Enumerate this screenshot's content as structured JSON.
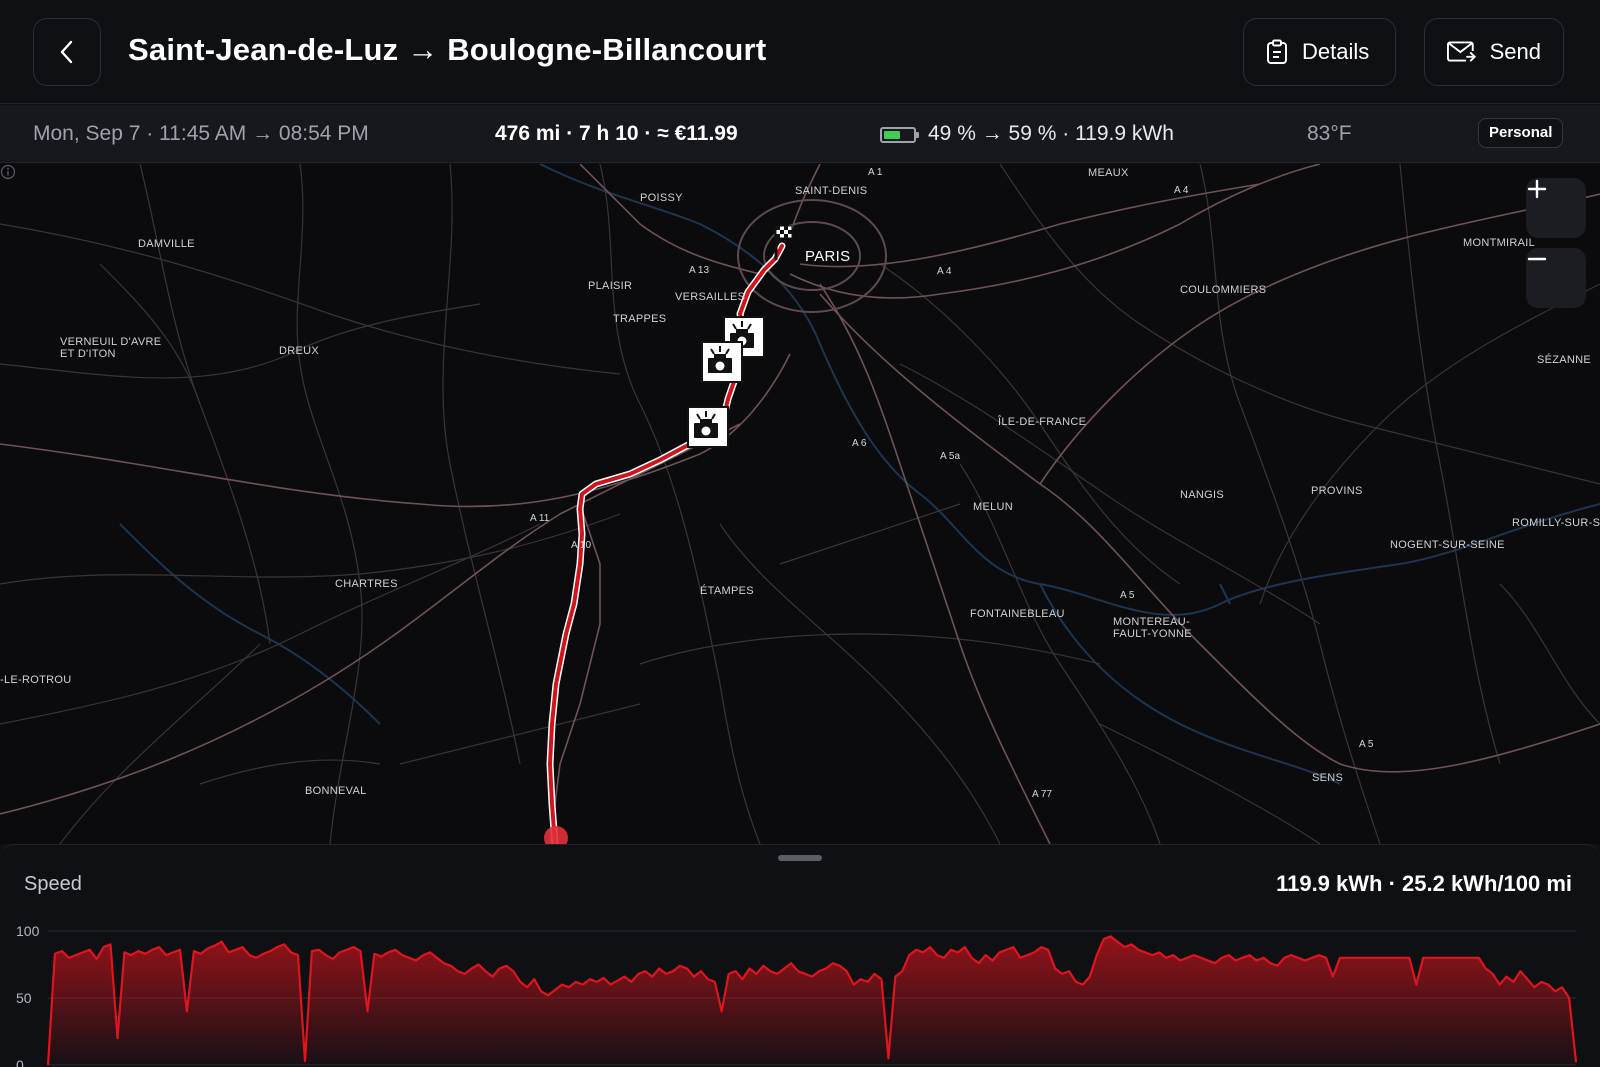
{
  "header": {
    "title": "Saint-Jean-de-Luz → Boulogne-Billancourt",
    "details_label": "Details",
    "send_label": "Send"
  },
  "summary": {
    "date_time": "Mon, Sep 7 · 11:45 AM → 08:54 PM",
    "trip": "476 mi · 7 h 10 · ≈ €11.99",
    "battery": "49 % → 59 % · 119.9 kWh",
    "battery_level_percent": 49,
    "temperature": "83°F",
    "badge": "Personal"
  },
  "map": {
    "places": [
      "SAINT-DENIS",
      "POISSY",
      "MEAUX",
      "DAMVILLE",
      "MONTMIRAIL",
      "PARIS",
      "PLAISIR",
      "VERSAILLES",
      "COULOMMIERS",
      "TRAPPES",
      "VERNEUIL D'AVRE ET D'ITON",
      "DREUX",
      "SÉZANNE",
      "ÎLE-DE-FRANCE",
      "NANGIS",
      "PROVINS",
      "MELUN",
      "ROMILLY-SUR-SEI",
      "NOGENT-SUR-SEINE",
      "CHARTRES",
      "ÉTAMPES",
      "FONTAINEBLEAU",
      "MONTEREAU-FAULT-YONNE",
      "-LE-ROTROU",
      "SENS",
      "BONNEVAL"
    ],
    "roads": [
      "A 1",
      "A 4",
      "A 13",
      "A 4",
      "A 6",
      "A 5a",
      "A 11",
      "A 10",
      "A 5",
      "A 5",
      "A 77"
    ],
    "route_color": "#d0141d",
    "zoom_in_icon": "plus-icon",
    "zoom_out_icon": "minus-icon"
  },
  "speed_panel": {
    "title": "Speed",
    "stats": "119.9 kWh · 25.2 kWh/100 mi",
    "y_ticks": [
      "100",
      "50",
      "0"
    ],
    "line_color": "#e0141c"
  },
  "chart_data": {
    "type": "area",
    "title": "Speed",
    "ylim": [
      0,
      100
    ],
    "yticks": [
      0,
      50,
      100
    ],
    "grid": true,
    "series": [
      {
        "values": [
          0,
          83,
          85,
          80,
          82,
          84,
          86,
          79,
          88,
          90,
          20,
          84,
          82,
          85,
          83,
          86,
          88,
          82,
          84,
          86,
          40,
          85,
          83,
          87,
          89,
          92,
          84,
          86,
          88,
          82,
          80,
          83,
          85,
          88,
          90,
          84,
          82,
          3,
          85,
          86,
          82,
          79,
          84,
          86,
          88,
          85,
          40,
          83,
          81,
          84,
          86,
          82,
          80,
          78,
          82,
          84,
          80,
          76,
          74,
          70,
          68,
          72,
          75,
          70,
          66,
          72,
          74,
          70,
          62,
          58,
          64,
          55,
          52,
          56,
          60,
          58,
          62,
          60,
          64,
          62,
          65,
          60,
          63,
          66,
          62,
          68,
          70,
          66,
          72,
          68,
          70,
          74,
          72,
          66,
          70,
          64,
          62,
          40,
          68,
          70,
          64,
          72,
          68,
          74,
          70,
          68,
          72,
          76,
          70,
          68,
          66,
          70,
          72,
          76,
          74,
          70,
          60,
          64,
          62,
          68,
          64,
          5,
          66,
          70,
          82,
          86,
          84,
          88,
          82,
          80,
          86,
          84,
          88,
          80,
          76,
          82,
          78,
          84,
          86,
          88,
          80,
          82,
          84,
          88,
          86,
          72,
          68,
          70,
          62,
          60,
          66,
          82,
          94,
          96,
          92,
          88,
          90,
          86,
          84,
          82,
          84,
          80,
          82,
          78,
          80,
          82,
          80,
          78,
          76,
          80,
          82,
          78,
          80,
          82,
          78,
          80,
          76,
          74,
          80,
          82,
          80,
          78,
          80,
          82,
          80,
          66,
          80,
          80,
          80,
          80,
          80,
          80,
          80,
          80,
          80,
          80,
          80,
          60,
          80,
          80,
          80,
          80,
          80,
          80,
          80,
          80,
          80,
          72,
          68,
          60,
          66,
          62,
          70,
          64,
          58,
          62,
          60,
          55,
          58,
          50,
          2
        ]
      }
    ]
  }
}
